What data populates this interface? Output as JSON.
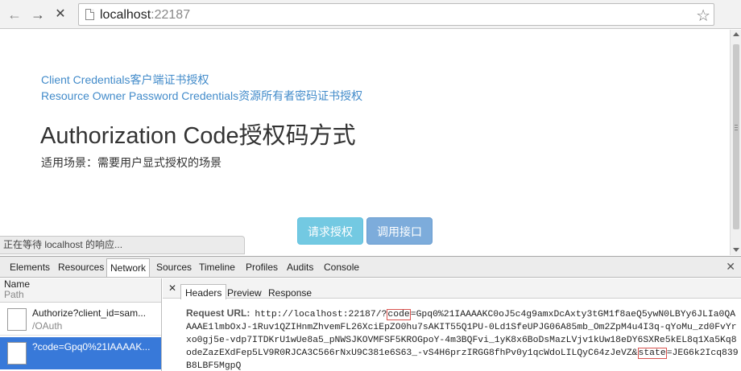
{
  "browser": {
    "url_host": "localhost",
    "url_port": ":22187",
    "status_text": "正在等待 localhost 的响应..."
  },
  "page": {
    "links": [
      "Client Credentials客户端证书授权",
      "Resource Owner Password Credentials资源所有者密码证书授权"
    ],
    "heading": "Authorization Code授权码方式",
    "scene": "适用场景：需要用户显式授权的场景",
    "buttons": {
      "authorize": "请求授权",
      "call_api": "调用接口"
    }
  },
  "devtools": {
    "tabs": [
      "Elements",
      "Resources",
      "Network",
      "Sources",
      "Timeline",
      "Profiles",
      "Audits",
      "Console"
    ],
    "active_tab": "Network",
    "columns": {
      "name": "Name",
      "path": "Path"
    },
    "requests": [
      {
        "name": "Authorize?client_id=sam...",
        "path": "/OAuth"
      },
      {
        "name": "?code=Gpq0%21IAAAAK..."
      }
    ],
    "detail_tabs": [
      "Headers",
      "Preview",
      "Response"
    ],
    "request_url": {
      "label": "Request URL:",
      "prefix": "http://localhost:22187/?",
      "code_key": "code",
      "code_value": "=Gpq0%21IAAAAKC0oJ5c4g9amxDcAxty3tGM1f8aeQ5ywN0LBYy6JLIa0QAAAAE1lmbOxJ-1Ruv1QZIHnmZhvemFL26XciEpZO0hu7sAKIT55Q1PU-0Ld1SfeUPJG06A85mb_Om2ZpM4u4I3q-qYoMu_zd0FvYrxo0gj5e-vdp7ITDKrU1wUe8a5_pNWSJKOVMFSF5KROGpoY-4m3BQFvi_1yK8x6BoDsMazLVjv1kUw18eDY6SXRe5kEL8q1Xa5Kq8odeZazEXdFep5LV9R0RJCA3C566rNxU9C381e6S63_-vS4H6przIRGG8fhPv0y1qcWdoLILQyC64zJeVZ&",
      "state_key": "state",
      "state_value": "=JEG6k2Icq839B8LBF5MgpQ"
    }
  }
}
